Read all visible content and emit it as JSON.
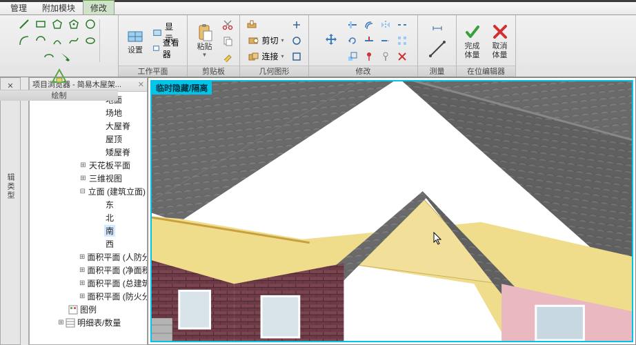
{
  "tabs": {
    "manage": "管理",
    "addons": "附加模块",
    "modify": "修改"
  },
  "ribbon": {
    "draw": {
      "title": "绘制"
    },
    "workplane": {
      "title": "工作平面",
      "settings": "设置",
      "show": "显示",
      "viewer": "查看器"
    },
    "clipboard": {
      "title": "剪贴板",
      "paste": "粘贴"
    },
    "geometry": {
      "title": "几何图形",
      "cut": "剪切",
      "join": "连接"
    },
    "modify": {
      "title": "修改"
    },
    "measure": {
      "title": "测量"
    },
    "inplace": {
      "title": "在位编辑器",
      "finish1": "完成",
      "finish2": "体量",
      "cancel1": "取消",
      "cancel2": "体量"
    }
  },
  "palette": {
    "label": "辑类型"
  },
  "browser": {
    "title": "项目浏览器 - 简易木屋架...",
    "items": {
      "ground": "地面",
      "site": "场地",
      "bigridge": "大屋脊",
      "roof": "屋顶",
      "lowridge": "矮屋脊",
      "ceilingplan": "天花板平面",
      "threeDview": "三维视图",
      "elev": "立面 (建筑立面)",
      "east": "东",
      "north": "北",
      "south": "南",
      "west": "西",
      "area1": "面积平面 (人防分区面",
      "area2": "面积平面 (净面积)",
      "area3": "面积平面 (总建筑面积",
      "area4": "面积平面 (防火分区面",
      "legend": "图例",
      "schedule": "明细表/数量"
    }
  },
  "viewport": {
    "isolate": "临时隐藏/隔离"
  }
}
